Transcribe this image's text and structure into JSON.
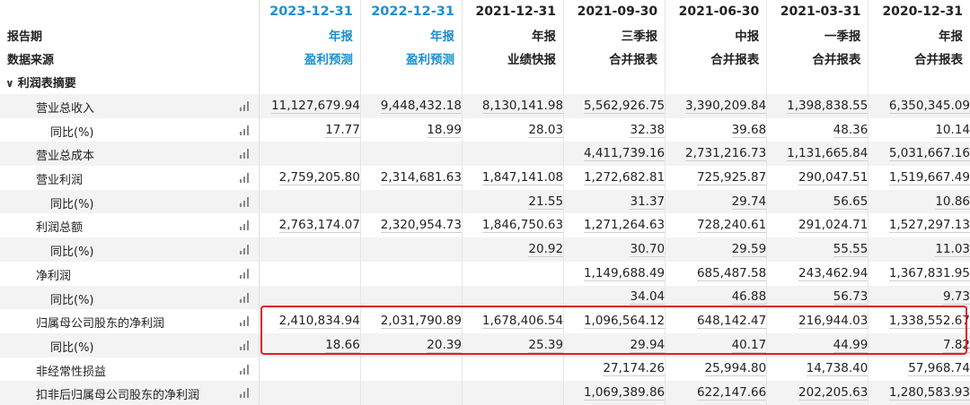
{
  "header": {
    "dates": [
      "2023-12-31",
      "2022-12-31",
      "2021-12-31",
      "2021-09-30",
      "2021-06-30",
      "2021-03-31",
      "2020-12-31"
    ],
    "report_label": "报告期",
    "report_types": [
      "年报",
      "年报",
      "年报",
      "三季报",
      "中报",
      "一季报",
      "年报"
    ],
    "source_label": "数据来源",
    "sources": [
      "盈利预测",
      "盈利预测",
      "业绩快报",
      "合并报表",
      "合并报表",
      "合并报表",
      "合并报表"
    ],
    "forecast_color": "#1a8fd6"
  },
  "section": {
    "title": "利润表摘要",
    "chevron": "chevron-down-icon"
  },
  "rows": [
    {
      "label": "营业总收入",
      "level": 1,
      "values": [
        "11,127,679.94",
        "9,448,432.18",
        "8,130,141.98",
        "5,562,926.75",
        "3,390,209.84",
        "1,398,838.55",
        "6,350,345.09"
      ]
    },
    {
      "label": "同比(%)",
      "level": 2,
      "values": [
        "17.77",
        "18.99",
        "28.03",
        "32.38",
        "39.68",
        "48.36",
        "10.14"
      ]
    },
    {
      "label": "营业总成本",
      "level": 1,
      "values": [
        "",
        "",
        "",
        "4,411,739.16",
        "2,731,216.73",
        "1,131,665.84",
        "5,031,667.16"
      ]
    },
    {
      "label": "营业利润",
      "level": 1,
      "values": [
        "2,759,205.80",
        "2,314,681.63",
        "1,847,141.08",
        "1,272,682.81",
        "725,925.87",
        "290,047.51",
        "1,519,667.49"
      ]
    },
    {
      "label": "同比(%)",
      "level": 2,
      "values": [
        "",
        "",
        "21.55",
        "31.37",
        "29.74",
        "56.65",
        "10.86"
      ]
    },
    {
      "label": "利润总额",
      "level": 1,
      "values": [
        "2,763,174.07",
        "2,320,954.73",
        "1,846,750.63",
        "1,271,264.63",
        "728,240.61",
        "291,024.71",
        "1,527,297.13"
      ]
    },
    {
      "label": "同比(%)",
      "level": 2,
      "values": [
        "",
        "",
        "20.92",
        "30.70",
        "29.59",
        "55.55",
        "11.03"
      ]
    },
    {
      "label": "净利润",
      "level": 1,
      "values": [
        "",
        "",
        "",
        "1,149,688.49",
        "685,487.58",
        "243,462.94",
        "1,367,831.95"
      ]
    },
    {
      "label": "同比(%)",
      "level": 2,
      "values": [
        "",
        "",
        "",
        "34.04",
        "46.88",
        "56.73",
        "9.73"
      ]
    },
    {
      "label": "归属母公司股东的净利润",
      "level": 1,
      "values": [
        "2,410,834.94",
        "2,031,790.89",
        "1,678,406.54",
        "1,096,564.12",
        "648,142.47",
        "216,944.03",
        "1,338,552.67"
      ]
    },
    {
      "label": "同比(%)",
      "level": 2,
      "values": [
        "18.66",
        "20.39",
        "25.39",
        "29.94",
        "40.17",
        "44.99",
        "7.82"
      ]
    },
    {
      "label": "非经常性损益",
      "level": 1,
      "values": [
        "",
        "",
        "",
        "27,174.26",
        "25,994.80",
        "14,738.40",
        "57,968.74"
      ]
    },
    {
      "label": "扣非后归属母公司股东的净利润",
      "level": 1,
      "values": [
        "",
        "",
        "",
        "1,069,389.86",
        "622,147.66",
        "202,205.63",
        "1,280,583.93"
      ]
    }
  ],
  "highlight_color": "#e02020"
}
